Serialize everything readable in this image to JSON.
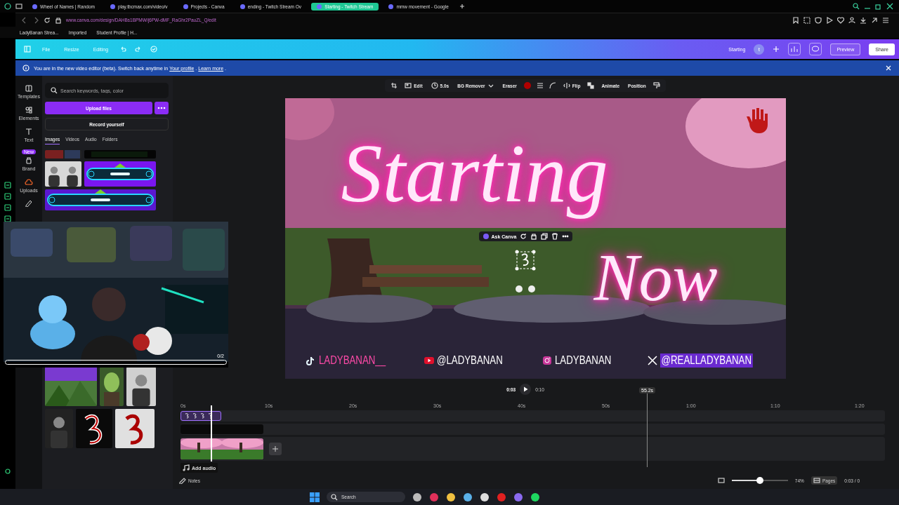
{
  "browser": {
    "tabs": [
      {
        "label": "Wheel of Names | Random",
        "selected": false
      },
      {
        "label": "play.tbcmax.com/video/v",
        "selected": false
      },
      {
        "label": "Projects - Canva",
        "selected": false
      },
      {
        "label": "ending - Twitch Stream Ov",
        "selected": false
      },
      {
        "label": "Starting - Twitch Stream",
        "selected": true
      },
      {
        "label": "mmw movement - Google",
        "selected": false
      }
    ],
    "url": "www.canva.com/design/DAHBs1BPMW/j6PW-dMF_RaGhr2PauZL_Q/edit",
    "bookmarks": [
      "LadyBanan Strea...",
      "Imported",
      "Student Profile | H..."
    ]
  },
  "header": {
    "menu": [
      "File",
      "Resize",
      "Editing"
    ],
    "title": "Starting",
    "avatar": "t",
    "buttons": [
      "Preview",
      "Share"
    ]
  },
  "banner": {
    "segments": [
      {
        "kind": "text",
        "text": "You are in the new video editor (beta). Switch back anytime in"
      },
      {
        "kind": "link",
        "text": "Your profile"
      },
      {
        "kind": "text",
        "text": "."
      },
      {
        "kind": "link",
        "text": "Learn more"
      },
      {
        "kind": "text",
        "text": "."
      }
    ]
  },
  "rail": [
    {
      "label": "Templates"
    },
    {
      "label": "Elements"
    },
    {
      "label": "Text"
    },
    {
      "label": "Brand",
      "badge": "New"
    },
    {
      "label": "Uploads"
    }
  ],
  "panel": {
    "search_placeholder": "Search keywords, tags, color",
    "upload": "Upload files",
    "record": "Record yourself",
    "tabs": [
      {
        "label": "Images",
        "selected": true
      },
      {
        "label": "Videos",
        "selected": false
      },
      {
        "label": "Audio",
        "selected": false
      },
      {
        "label": "Folders",
        "selected": false
      }
    ]
  },
  "webcam": {
    "counter": "0/2",
    "progress": {
      "level": 0
    }
  },
  "toolbar": {
    "items": [
      "Edit",
      "5.0s",
      "BG Remover",
      "Eraser",
      "Flip",
      "Animate",
      "Position"
    ]
  },
  "design": {
    "title_words": [
      "Starting",
      "Now"
    ],
    "context_label": "Ask Canva",
    "socials": [
      {
        "kind": "tiktok",
        "handle": "LADYBANAN__"
      },
      {
        "kind": "youtube",
        "handle": "@LADYBANAN"
      },
      {
        "kind": "instagram",
        "handle": "LADYBANAN"
      },
      {
        "kind": "x",
        "handle": "@REALLADYBANAN"
      }
    ]
  },
  "playback": {
    "current": "0:03",
    "total": "0:10"
  },
  "timeline": {
    "ticks": [
      "0s",
      "10s",
      "20s",
      "30s",
      "40s",
      "50s",
      "1:00",
      "1:10",
      "1:20"
    ],
    "marker": "55.2s",
    "add_audio": "Add audio"
  },
  "bottom": {
    "notes": "Notes",
    "zoom": {
      "level": 0.5,
      "reading": "74%"
    },
    "pages": "Pages",
    "time": "0:03 / 0"
  },
  "taskbar": {
    "search": "Search"
  }
}
